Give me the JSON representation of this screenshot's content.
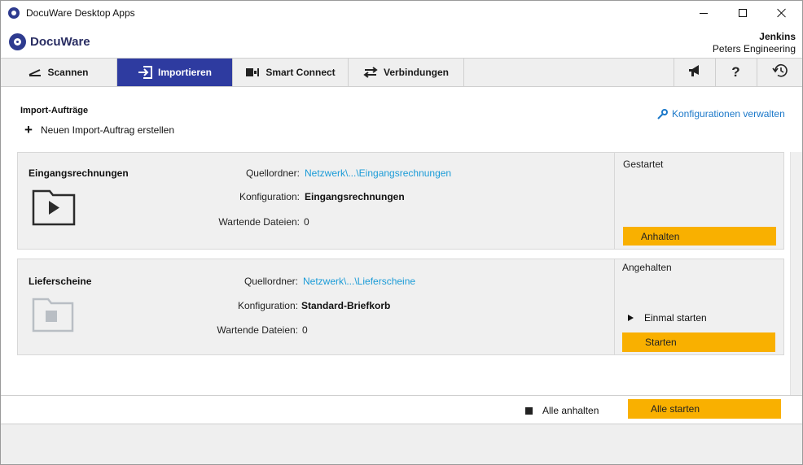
{
  "window": {
    "title": "DocuWare Desktop Apps"
  },
  "brand": {
    "logo_text": "DocuWare"
  },
  "user": {
    "name": "Jenkins",
    "company": "Peters Engineering"
  },
  "tabs": [
    {
      "label": "Scannen",
      "icon": "scanner-icon",
      "active": false
    },
    {
      "label": "Importieren",
      "icon": "import-icon",
      "active": true
    },
    {
      "label": "Smart Connect",
      "icon": "smart-connect-icon",
      "active": false
    },
    {
      "label": "Verbindungen",
      "icon": "swap-arrows-icon",
      "active": false
    }
  ],
  "toolbar": {
    "icons": [
      "megaphone-icon",
      "help-icon",
      "history-icon"
    ],
    "help_glyph": "?"
  },
  "content": {
    "section_title": "Import-Aufträge",
    "new_job_label": "Neuen Import-Auftrag erstellen",
    "config_link": "Konfigurationen verwalten"
  },
  "jobs": [
    {
      "name": "Eingangsrechnungen",
      "source_label": "Quellordner:",
      "source_value": "Netzwerk\\...\\Eingangsrechnungen",
      "config_label": "Konfiguration:",
      "config_value": "Eingangsrechnungen",
      "waiting_label": "Wartende Dateien:",
      "waiting_value": "0",
      "status": "Gestartet",
      "action_label": "Anhalten",
      "running": true
    },
    {
      "name": "Lieferscheine",
      "source_label": "Quellordner:",
      "source_value": "Netzwerk\\...\\Lieferscheine",
      "config_label": "Konfiguration:",
      "config_value": "Standard-Briefkorb",
      "waiting_label": "Wartende Dateien:",
      "waiting_value": "0",
      "status": "Angehalten",
      "run_once_label": "Einmal starten",
      "action_label": "Starten",
      "running": false
    }
  ],
  "footer": {
    "stop_all_label": "Alle anhalten",
    "start_all_label": "Alle starten"
  },
  "colors": {
    "accent_blue": "#2e3ba0",
    "action_orange": "#f9b000",
    "link_blue": "#1a9bd7"
  }
}
